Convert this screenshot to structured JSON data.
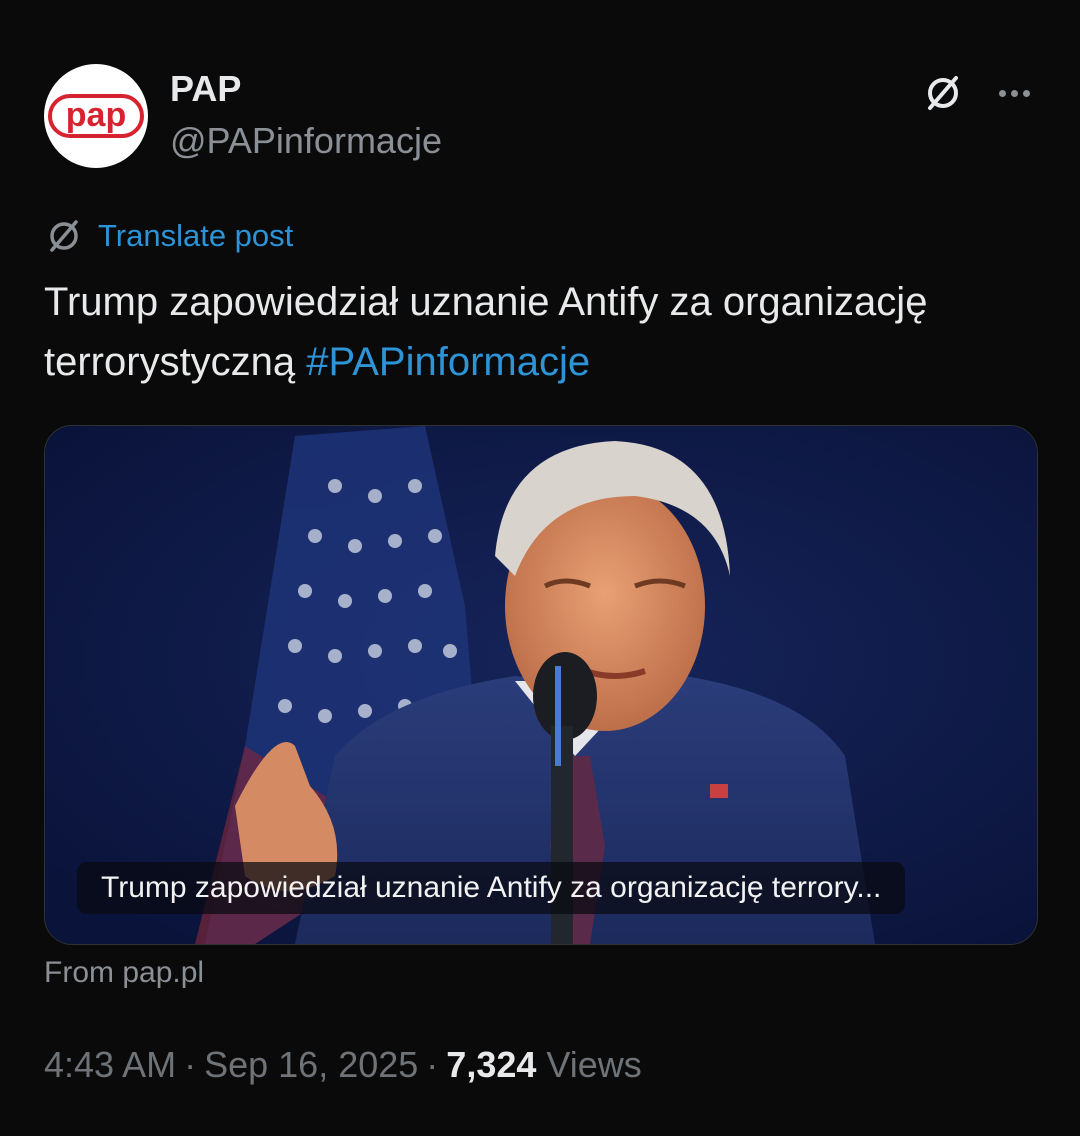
{
  "author": {
    "name": "PAP",
    "handle": "@PAPinformacje",
    "avatar_text": "pap"
  },
  "icons": {
    "grok": "grok-slash-circle-icon",
    "more": "more-horizontal-icon",
    "translate": "grok-slash-circle-icon"
  },
  "translate": {
    "label": "Translate post"
  },
  "post": {
    "text": "Trump zapowiedział uznanie Antify za organizację terrorystyczną ",
    "hashtag": "#PAPinformacje"
  },
  "card": {
    "caption": "Trump zapowiedział uznanie Antify za organizację terrory...",
    "source": "From pap.pl"
  },
  "meta": {
    "time": "4:43 AM",
    "separator": "·",
    "date": "Sep 16, 2025",
    "views_count": "7,324",
    "views_label": "Views"
  },
  "colors": {
    "background": "#0a0a0a",
    "link": "#2e94d8",
    "secondary_text": "#8b9096",
    "brand_red": "#d7232f"
  }
}
